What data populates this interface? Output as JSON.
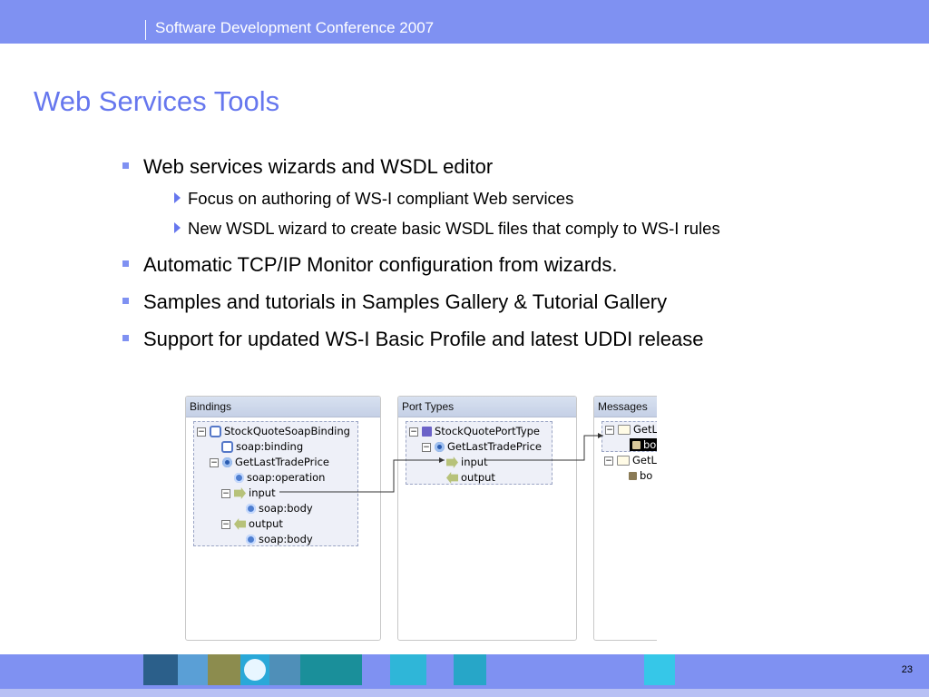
{
  "header": {
    "conference": "Software Development Conference 2007"
  },
  "slide": {
    "title": "Web Services Tools",
    "bullets": [
      {
        "text": "Web services wizards and WSDL editor",
        "sub": [
          "Focus on authoring of WS-I compliant Web services",
          "New WSDL wizard to create basic WSDL files that comply to WS-I rules"
        ]
      },
      {
        "text": "Automatic TCP/IP Monitor configuration from wizards."
      },
      {
        "text": "Samples and tutorials in Samples Gallery & Tutorial Gallery"
      },
      {
        "text": "Support for updated WS-I Basic Profile and latest UDDI release"
      }
    ]
  },
  "screenshot": {
    "bindings": {
      "title": "Bindings",
      "items": [
        "StockQuoteSoapBinding",
        "soap:binding",
        "GetLastTradePrice",
        "soap:operation",
        "input",
        "soap:body",
        "output",
        "soap:body"
      ]
    },
    "port_types": {
      "title": "Port Types",
      "items": [
        "StockQuotePortType",
        "GetLastTradePrice",
        "input",
        "output"
      ]
    },
    "messages": {
      "title": "Messages",
      "items": [
        "GetL",
        "bo",
        "GetL",
        "bo"
      ]
    }
  },
  "footer": {
    "page_number": "23"
  },
  "colors": {
    "accent": "#7f91f2",
    "title": "#6677ee"
  }
}
